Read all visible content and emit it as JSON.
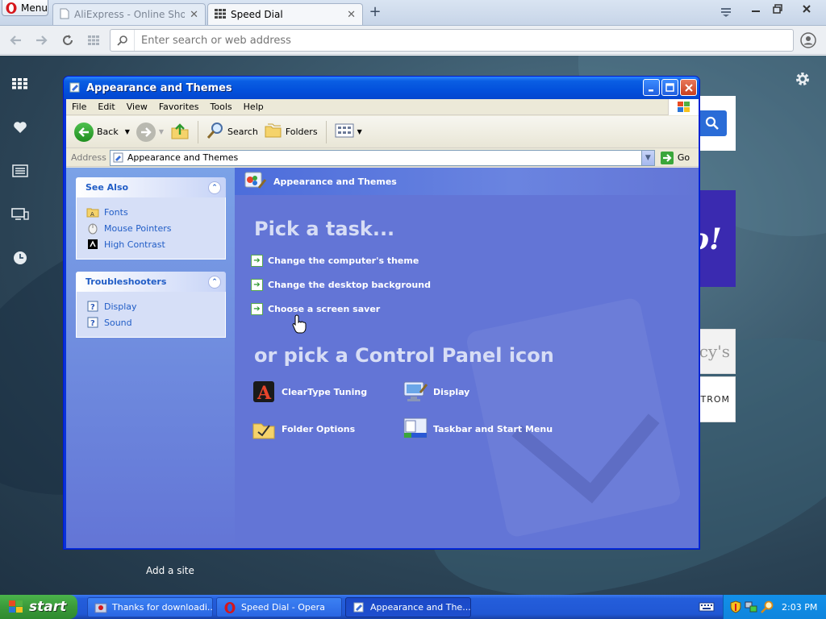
{
  "opera": {
    "menu_label": "Menu",
    "tabs": [
      {
        "title": "AliExpress - Online Shopping",
        "active": false
      },
      {
        "title": "Speed Dial",
        "active": true
      }
    ],
    "address_placeholder": "Enter search or web address"
  },
  "speed_dial": {
    "add_site_label": "Add a site",
    "tiles": {
      "yahoo_text": "o!",
      "macys_text": "cy's",
      "nordstrom_text": "TROM"
    }
  },
  "explorer": {
    "title": "Appearance and Themes",
    "menu": [
      "File",
      "Edit",
      "View",
      "Favorites",
      "Tools",
      "Help"
    ],
    "toolbar": {
      "back": "Back",
      "search": "Search",
      "folders": "Folders"
    },
    "address": {
      "label": "Address",
      "value": "Appearance and Themes",
      "go": "Go"
    },
    "see_also": {
      "title": "See Also",
      "links": [
        "Fonts",
        "Mouse Pointers",
        "High Contrast"
      ]
    },
    "troubleshooters": {
      "title": "Troubleshooters",
      "links": [
        "Display",
        "Sound"
      ]
    },
    "main": {
      "header": "Appearance and Themes",
      "pick_task": "Pick a task...",
      "tasks": [
        "Change the computer's theme",
        "Change the desktop background",
        "Choose a screen saver"
      ],
      "pick_icon": "or pick a Control Panel icon",
      "icons": [
        "ClearType Tuning",
        "Display",
        "Folder Options",
        "Taskbar and Start Menu"
      ]
    }
  },
  "taskbar": {
    "start_label": "start",
    "buttons": [
      "Thanks for downloadi...",
      "Speed Dial - Opera",
      "Appearance and The..."
    ],
    "clock": "2:03 PM"
  },
  "colors": {
    "xp_blue": "#0831d9",
    "task_pane": "#6375d6",
    "link_blue": "#215dc6"
  }
}
